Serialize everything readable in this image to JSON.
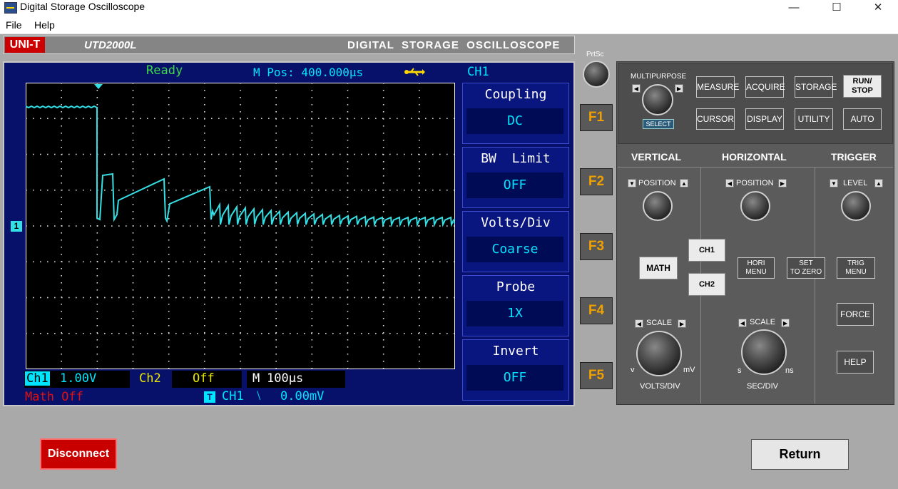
{
  "window": {
    "title": "Digital Storage Oscilloscope",
    "minimize": "—",
    "maximize": "☐",
    "close": "✕"
  },
  "menu": [
    "File",
    "Help"
  ],
  "header": {
    "brand": "UNI-T",
    "model": "UTD2000L",
    "title": "DIGITAL  STORAGE  OSCILLOSCOPE"
  },
  "screen": {
    "status": "Ready",
    "mpos": "M Pos: 400.000µs",
    "channel": "CH1",
    "ch1_marker": "1",
    "menu": [
      {
        "label": "Coupling",
        "value": "DC"
      },
      {
        "label": "BW  Limit",
        "value": "OFF"
      },
      {
        "label": "Volts/Div",
        "value": "Coarse"
      },
      {
        "label": "Probe",
        "value": "1X"
      },
      {
        "label": "Invert",
        "value": "OFF"
      }
    ],
    "bottom": {
      "ch1_label": "Ch1",
      "ch1_value": "1.00V",
      "ch2_label": "Ch2",
      "ch2_value": "Off",
      "time_label": "M",
      "time_value": "100µs",
      "math": "Math Off",
      "trig_icon": "T",
      "trig_source": "CH1",
      "trig_slope": "⧵",
      "trig_level": "0.00mV"
    }
  },
  "fkeys": [
    "F1",
    "F2",
    "F3",
    "F4",
    "F5"
  ],
  "prtsc": "PrtSc",
  "panel": {
    "multipurpose": "MULTIPURPOSE",
    "select": "SELECT",
    "top_buttons": [
      "MEASURE",
      "ACQUIRE",
      "STORAGE",
      "CURSOR",
      "DISPLAY",
      "UTILITY",
      "AUTO"
    ],
    "run_stop": [
      "RUN/",
      "STOP"
    ],
    "sections": {
      "vertical": "VERTICAL",
      "horizontal": "HORIZONTAL",
      "trigger": "TRIGGER"
    },
    "position": "POSITION",
    "level": "LEVEL",
    "math": "MATH",
    "ch1": "CH1",
    "ch2": "CH2",
    "hori_menu": [
      "HORI",
      "MENU"
    ],
    "set_to_zero": [
      "SET",
      "TO ZERO"
    ],
    "trig_menu": [
      "TRIG",
      "MENU"
    ],
    "force": "FORCE",
    "help": "HELP",
    "scale": "SCALE",
    "volts_div": "VOLTS/DIV",
    "sec_div": "SEC/DIV",
    "v": "v",
    "mv": "mV",
    "s": "s",
    "ns": "ns"
  },
  "buttons": {
    "disconnect": "Disconnect",
    "return": "Return"
  },
  "colors": {
    "screen_bg": "#07116a",
    "trace": "#33e0e6",
    "grid": "#ffffff",
    "ready": "#3dd94a",
    "ch1": "#00e5ff",
    "ch2": "#e8e800",
    "math": "#e01010",
    "fkey": "#f0a000",
    "disconnect": "#c80000"
  }
}
